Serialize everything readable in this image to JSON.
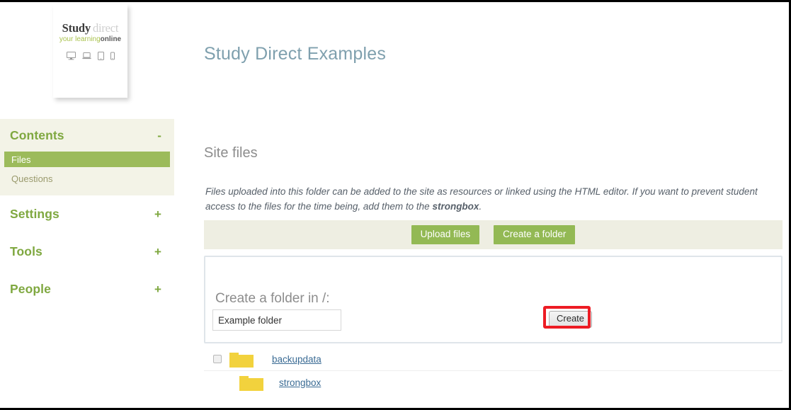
{
  "logo": {
    "word_primary": "Study",
    "word_secondary": "direct",
    "tagline_green": "your learning",
    "tagline_dark": "online",
    "device_icons": [
      "desktop-monitor-icon",
      "laptop-icon",
      "tablet-icon",
      "phone-icon"
    ]
  },
  "sidebar": {
    "sections": [
      {
        "label": "Contents",
        "sign": "-",
        "expanded": true,
        "items": [
          {
            "label": "Files",
            "active": true
          },
          {
            "label": "Questions",
            "active": false
          }
        ]
      },
      {
        "label": "Settings",
        "sign": "+",
        "expanded": false,
        "items": []
      },
      {
        "label": "Tools",
        "sign": "+",
        "expanded": false,
        "items": []
      },
      {
        "label": "People",
        "sign": "+",
        "expanded": false,
        "items": []
      }
    ]
  },
  "main": {
    "page_title": "Study Direct Examples",
    "section_title": "Site files",
    "intro_lead": "Files uploaded into this folder can be added to the site as resources or linked using the HTML editor. If you want to prevent student access to the files for the time being, add them to the ",
    "intro_bold": "strongbox",
    "intro_tail": ".",
    "toolbar": {
      "upload_label": "Upload files",
      "create_folder_label": "Create a folder"
    },
    "create_panel": {
      "title": "Create a folder in /:",
      "input_value": "Example folder",
      "input_placeholder": "",
      "submit_label": "Create",
      "highlight_color": "#ed1c24"
    },
    "files": [
      {
        "name": "backupdata",
        "icon": "folder-icon",
        "has_checkbox": true,
        "indented": false
      },
      {
        "name": "strongbox",
        "icon": "folder-icon",
        "has_checkbox": false,
        "indented": true
      }
    ]
  },
  "colors": {
    "brand_green": "#7fa840",
    "button_green": "#93b954",
    "active_green": "#9cbb5b",
    "sidebar_cream": "#f3f3e7",
    "toolbar_band": "#eeeee2",
    "title_blue": "#7fa0ae",
    "link_blue": "#3a6b94",
    "folder_yellow": "#f2d23d"
  }
}
